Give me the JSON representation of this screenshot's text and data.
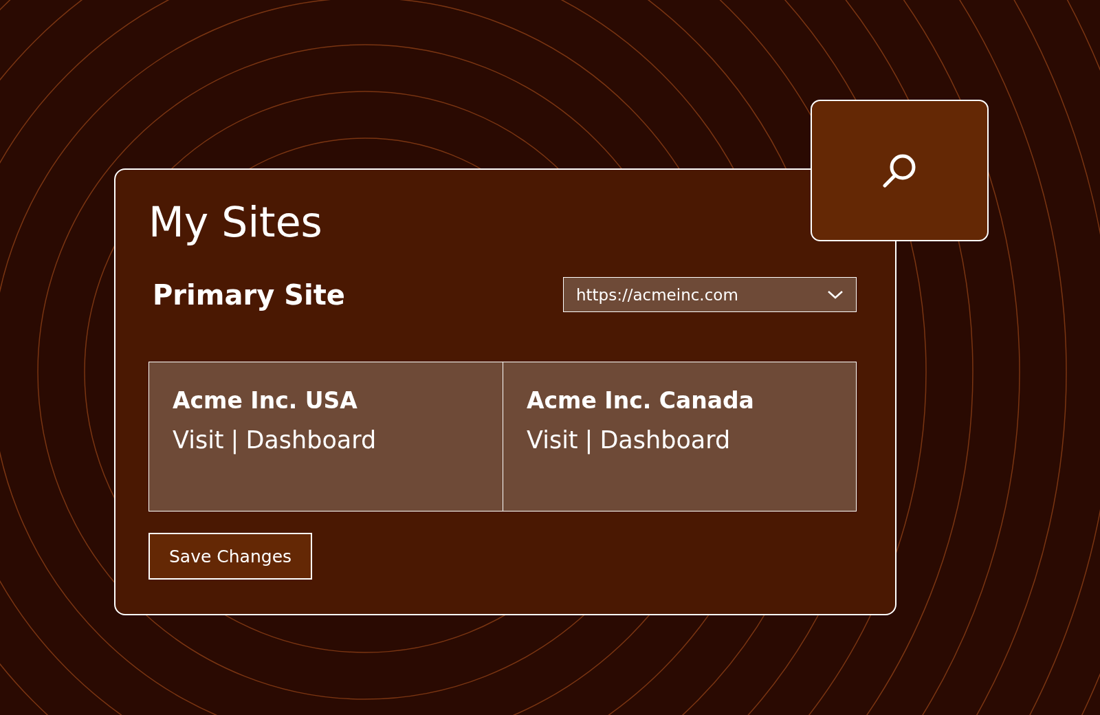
{
  "title": "My Sites",
  "primary_site": {
    "label": "Primary Site",
    "dropdown": {
      "value": "https://acmeinc.com"
    }
  },
  "sites": [
    {
      "name": "Acme Inc. USA",
      "links": [
        "Visit",
        "Dashboard"
      ],
      "separator": "|"
    },
    {
      "name": "Acme Inc. Canada",
      "links": [
        "Visit",
        "Dashboard"
      ],
      "separator": "|"
    }
  ],
  "save_button": "Save Changes"
}
